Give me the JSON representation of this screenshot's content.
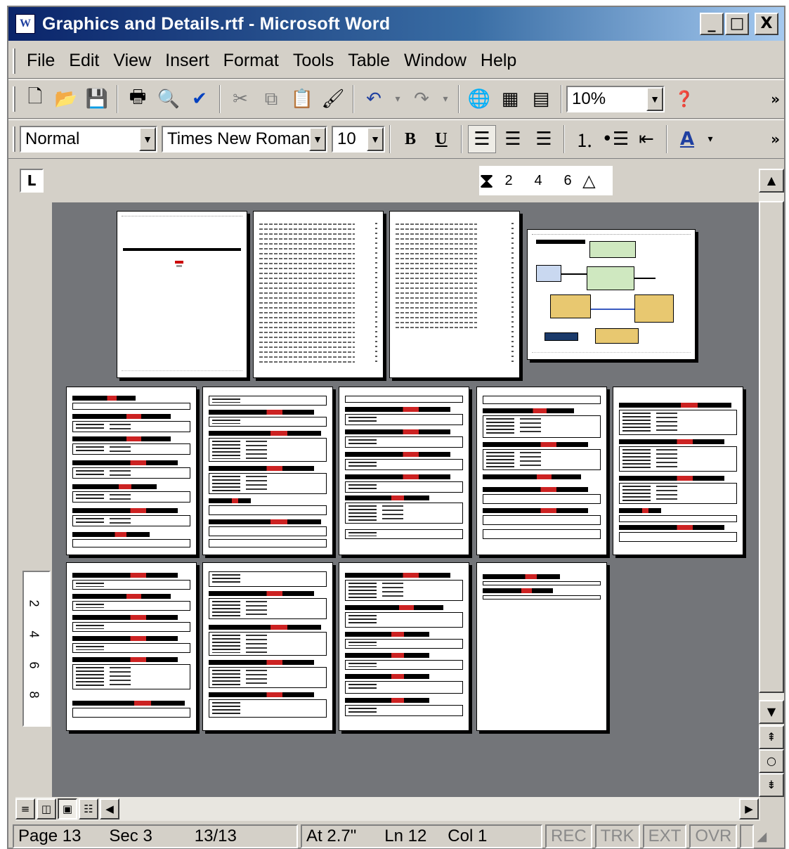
{
  "window": {
    "title": "Graphics and Details.rtf - Microsoft Word",
    "app_icon_letter": "W",
    "minimize": "_",
    "maximize": "□",
    "close": "X"
  },
  "menu": [
    "File",
    "Edit",
    "View",
    "Insert",
    "Format",
    "Tools",
    "Table",
    "Window",
    "Help"
  ],
  "standard_toolbar": {
    "icons": [
      "new-icon",
      "open-icon",
      "save-icon",
      "print-icon",
      "print-preview-icon",
      "spelling-icon",
      "cut-icon",
      "copy-icon",
      "paste-icon",
      "format-painter-icon",
      "undo-icon",
      "redo-icon",
      "hyperlink-icon",
      "tables-borders-icon",
      "insert-table-icon",
      "help-icon"
    ],
    "zoom": "10%",
    "overflow": "»"
  },
  "formatting_toolbar": {
    "style": "Normal",
    "font": "Times New Roman",
    "size": "10",
    "bold": "B",
    "underline": "U",
    "font_color_letter": "A",
    "icons": [
      "align-left-icon",
      "center-icon",
      "align-right-icon",
      "numbering-icon",
      "bullets-icon",
      "decrease-indent-icon"
    ],
    "overflow": "»"
  },
  "ruler": {
    "corner": "L",
    "h_ticks": [
      "2",
      "4",
      "6"
    ],
    "v_ticks": [
      "2",
      "4",
      "6",
      "8"
    ]
  },
  "status": {
    "page": "Page 13",
    "sec": "Sec 3",
    "page_of": "13/13",
    "at": "At 2.7\"",
    "ln": "Ln 12",
    "col": "Col 1",
    "rec": "REC",
    "trk": "TRK",
    "ext": "EXT",
    "ovr": "OVR"
  },
  "colors": {
    "title_start": "#0a246a",
    "title_end": "#a6caf0",
    "chrome": "#d4d0c8",
    "doc_background": "#737579",
    "red_text": "#c22222"
  }
}
